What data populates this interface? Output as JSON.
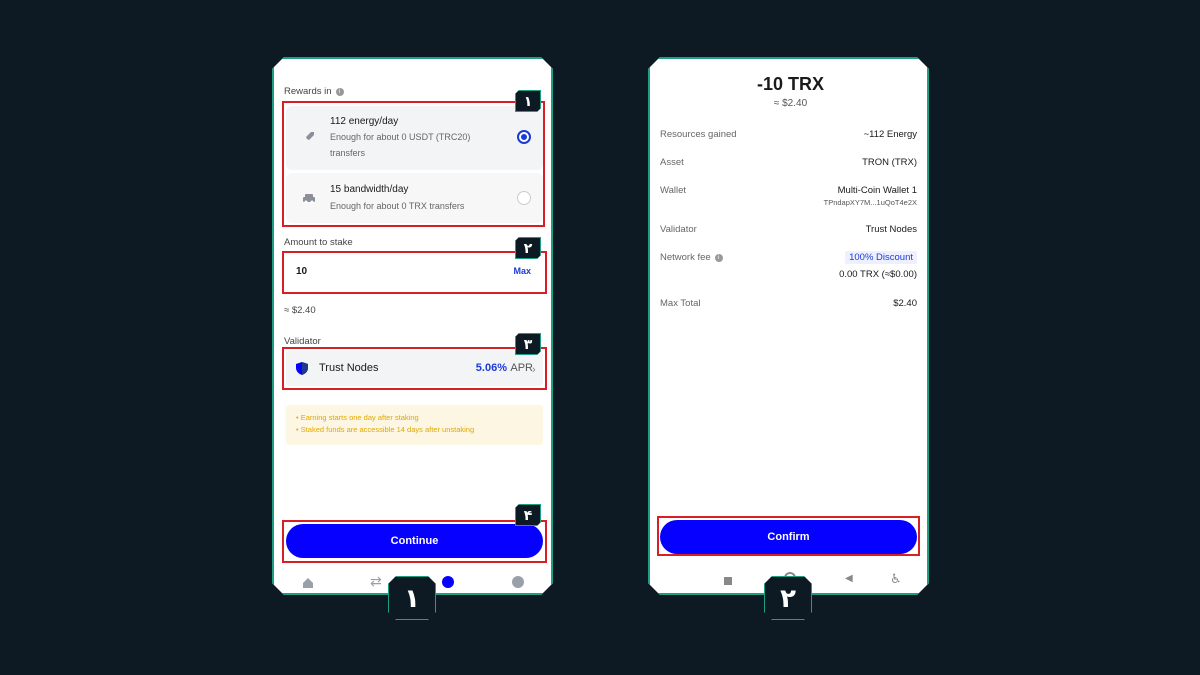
{
  "screen1": {
    "rewards_label": "Rewards in",
    "options": [
      {
        "title": "112 energy/day",
        "desc_line1": "Enough for about 0 USDT (TRC20)",
        "desc_line2": "transfers",
        "icon": "rocket-icon",
        "selected": true
      },
      {
        "title": "15 bandwidth/day",
        "desc_line1": "Enough for about 0 TRX transfers",
        "icon": "car-icon",
        "selected": false
      }
    ],
    "amount_label": "Amount to stake",
    "amount_value": "10",
    "max_label": "Max",
    "amount_fiat": "≈ $2.40",
    "validator_label": "Validator",
    "validator_name": "Trust Nodes",
    "validator_apr_value": "5.06%",
    "validator_apr_unit": "APR",
    "notice_line1": "• Earning starts one day after staking",
    "notice_line2": "• Staked funds are accessible 14 days after unstaking",
    "continue_label": "Continue",
    "badges": [
      "۱",
      "۲",
      "۳",
      "۴"
    ],
    "phone_badge": "۱"
  },
  "screen2": {
    "amount": "-10 TRX",
    "fiat": "≈ $2.40",
    "rows": {
      "resources_label": "Resources gained",
      "resources_value": "~112 Energy",
      "asset_label": "Asset",
      "asset_value": "TRON (TRX)",
      "wallet_label": "Wallet",
      "wallet_name": "Multi-Coin Wallet 1",
      "wallet_address": "TPndapXY7M...1uQoT4e2X",
      "validator_label": "Validator",
      "validator_value": "Trust Nodes",
      "fee_label": "Network fee",
      "fee_discount": "100% Discount",
      "fee_value": "0.00 TRX (≈$0.00)",
      "max_total_label": "Max Total",
      "max_total_value": "$2.40"
    },
    "confirm_label": "Confirm",
    "phone_badge": "۲"
  },
  "colors": {
    "background": "#0d1a24",
    "frame": "#1e9e82",
    "accent": "#0500ff",
    "highlight_box": "#d81f26",
    "notice_bg": "#fdf6e3",
    "notice_text": "#e0a800"
  }
}
